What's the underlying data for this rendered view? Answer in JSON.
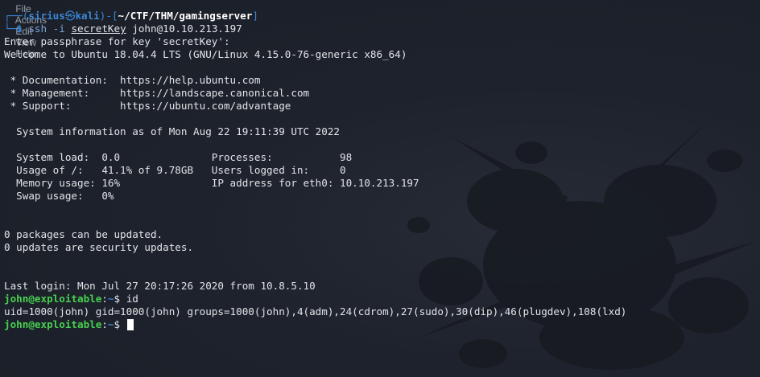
{
  "menu": [
    "File",
    "Actions",
    "Edit",
    "View",
    "Help"
  ],
  "prompt1": {
    "corner_top": "┌──(",
    "user": "sirius",
    "at_symbol": "㉿",
    "host": "kali",
    "mid": ")-[",
    "path": "~/CTF/THM/gamingserver",
    "end": "]",
    "corner_bottom": "└─",
    "dollar": "$ ",
    "cmd": "ssh",
    "flag": " -i ",
    "keyfile": "secretKey",
    "target": " john@10.10.213.197"
  },
  "output": {
    "passphrase": "Enter passphrase for key 'secretKey':",
    "welcome": "Welcome to Ubuntu 18.04.4 LTS (GNU/Linux 4.15.0-76-generic x86_64)",
    "doc": " * Documentation:  https://help.ubuntu.com",
    "mgmt": " * Management:     https://landscape.canonical.com",
    "support": " * Support:        https://ubuntu.com/advantage",
    "sysinfo": "  System information as of Mon Aug 22 19:11:39 UTC 2022",
    "row1": "  System load:  0.0               Processes:           98",
    "row2": "  Usage of /:   41.1% of 9.78GB   Users logged in:     0",
    "row3": "  Memory usage: 16%               IP address for eth0: 10.10.213.197",
    "row4": "  Swap usage:   0%",
    "pkgs": "0 packages can be updated.",
    "sec": "0 updates are security updates.",
    "lastlogin": "Last login: Mon Jul 27 20:17:26 2020 from 10.8.5.10",
    "id_output": "uid=1000(john) gid=1000(john) groups=1000(john),4(adm),24(cdrom),27(sudo),30(dip),46(plugdev),108(lxd)"
  },
  "remote_prompt": {
    "userhost": "john@exploitable",
    "colon": ":",
    "path": "~",
    "dollar": "$ ",
    "cmd": "id"
  },
  "colors": {
    "background": "#1d212b",
    "prompt_blue": "#3b86d6",
    "prompt_green": "#47d150",
    "text": "#e2e4e8"
  }
}
